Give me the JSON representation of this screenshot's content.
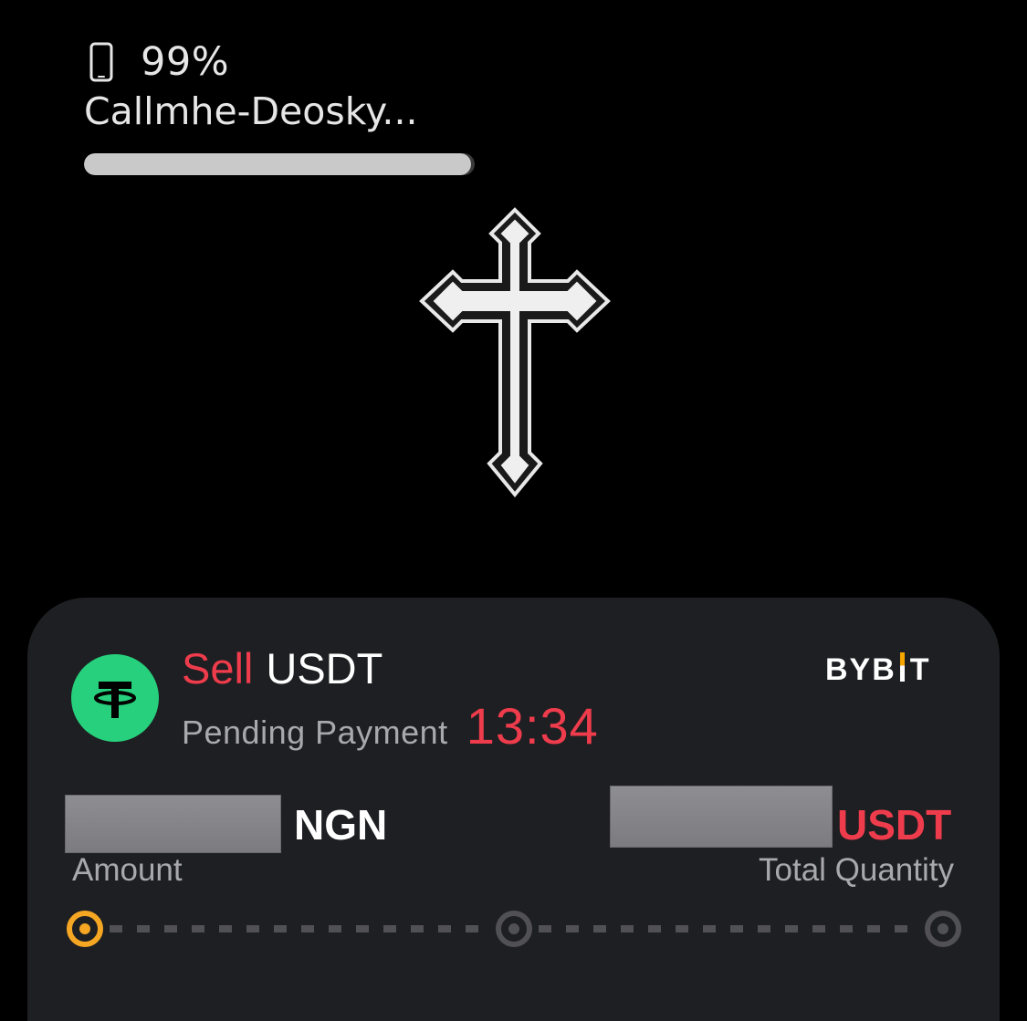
{
  "battery_widget": {
    "device_icon": "phone-icon",
    "percent": "99%",
    "level": 0.99,
    "device_name": "Callmhe-Deosky..."
  },
  "live_activity": {
    "logo_icon": "tether-icon",
    "order_side": "Sell",
    "coin": "USDT",
    "status": "Pending Payment",
    "timer": "13:34",
    "exchange_logo": "BYBIT",
    "amount_currency": "NGN",
    "amount_caption": "Amount",
    "quantity_currency": "USDT",
    "quantity_caption": "Total Quantity",
    "progress": {
      "total_steps": 3,
      "current_step": 1
    }
  },
  "colors": {
    "sell_red": "#ef3c4c",
    "tether_green": "#26d07c",
    "progress_active": "#f5a623",
    "progress_inactive": "#505055",
    "card_background": "#1e1f22"
  }
}
